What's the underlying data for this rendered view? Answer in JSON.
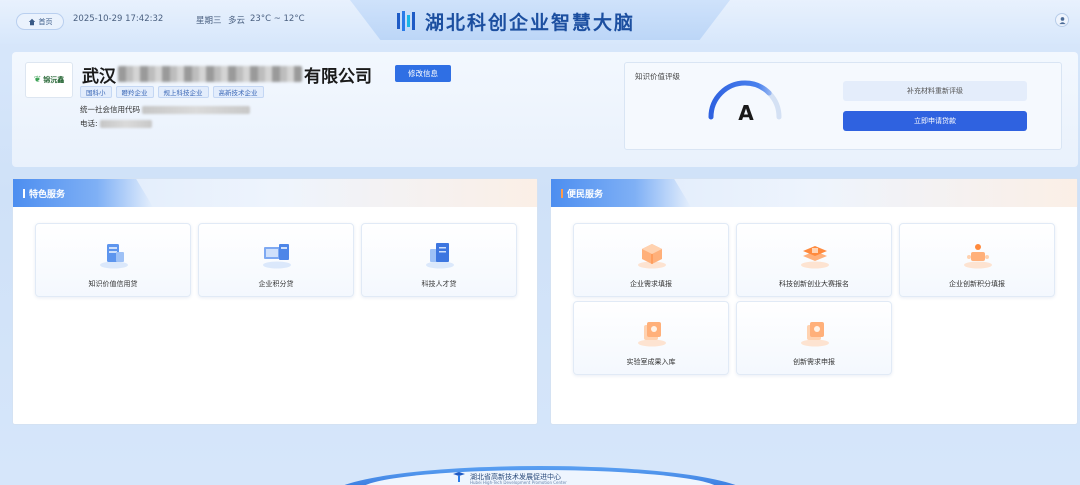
{
  "topbar": {
    "home_label": "首页",
    "datetime": "2025-10-29  17:42:32",
    "weekday": "星期三",
    "weather": "多云",
    "temperature": "23°C ~ 12°C",
    "title": "湖北科创企业智慧大脑"
  },
  "company": {
    "name_prefix": "武汉",
    "name_suffix": "有限公司",
    "logo_text": "锦沅鑫",
    "edit_label": "修改信息",
    "tags": [
      "国科小",
      "瞪羚企业",
      "规上科技企业",
      "高新技术企业"
    ],
    "credit_code_label": "统一社会信用代码",
    "phone_label": "电话:"
  },
  "valuation": {
    "label": "知识价值评级",
    "grade": "A",
    "gauge_level": 0.75,
    "supplement_label": "补充材料重新评级",
    "apply_label": "立即申请贷款",
    "accent": "#2f62e0"
  },
  "special_services": {
    "title": "特色服务",
    "items": [
      {
        "label": "知识价值信用贷",
        "icon": "server-icon"
      },
      {
        "label": "企业积分贷",
        "icon": "computer-icon"
      },
      {
        "label": "科技人才贷",
        "icon": "documents-icon"
      }
    ]
  },
  "convenience_services": {
    "title": "便民服务",
    "items": [
      {
        "label": "企业需求填报",
        "icon": "cube-icon"
      },
      {
        "label": "科技创新创业大赛报名",
        "icon": "layers-icon"
      },
      {
        "label": "企业创新积分填报",
        "icon": "nodes-icon"
      },
      {
        "label": "实验室成果入库",
        "icon": "stack-icon"
      },
      {
        "label": "创新需求申报",
        "icon": "stack-icon"
      }
    ]
  },
  "footer": {
    "org_name": "湖北省高新技术发展促进中心",
    "org_name_en": "Hubei High-Tech Development Promotion Center"
  }
}
